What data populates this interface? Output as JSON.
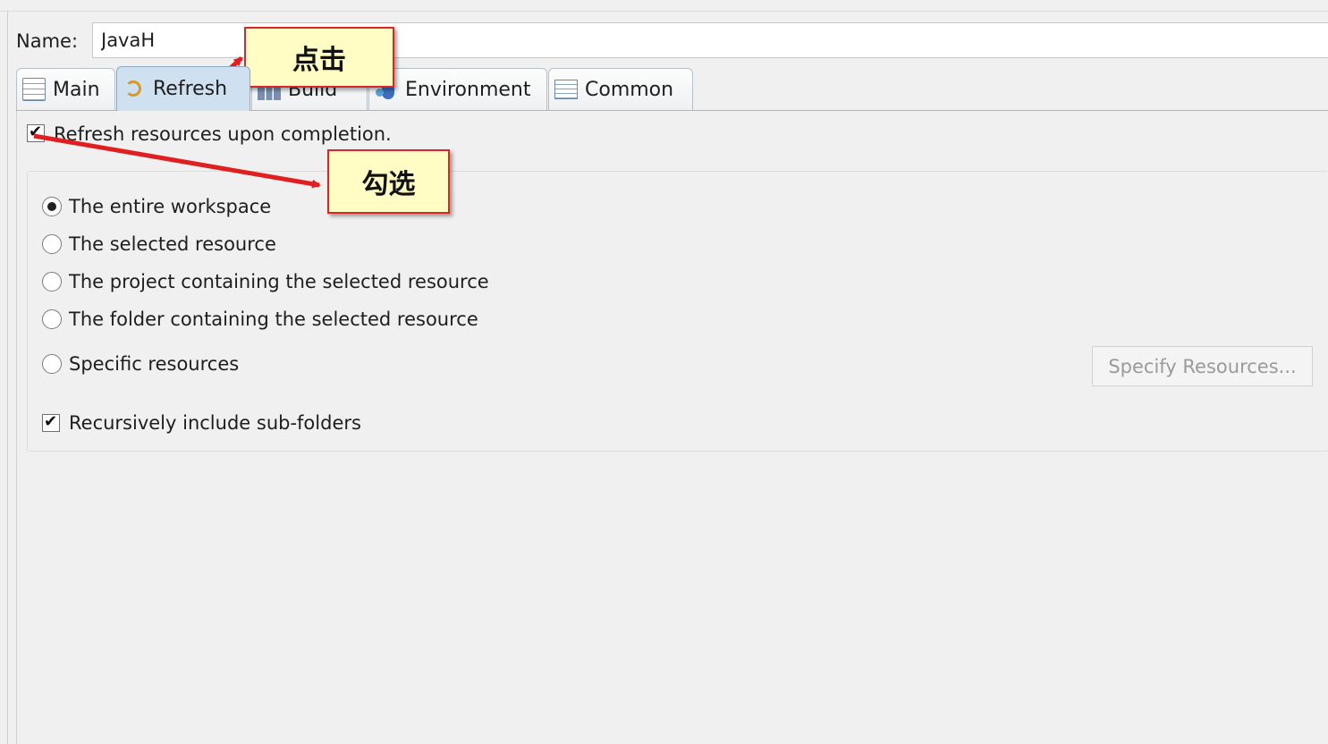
{
  "name_row": {
    "label": "Name:",
    "value": "JavaH"
  },
  "tabs": [
    {
      "label": "Main",
      "icon": "main-tab-icon",
      "active": false
    },
    {
      "label": "Refresh",
      "icon": "refresh-icon",
      "active": true
    },
    {
      "label": "Build",
      "icon": "build-icon",
      "active": false
    },
    {
      "label": "Environment",
      "icon": "environment-icon",
      "active": false
    },
    {
      "label": "Common",
      "icon": "common-icon",
      "active": false
    }
  ],
  "refresh": {
    "refresh_on_completion_label": "Refresh resources upon completion.",
    "refresh_on_completion_checked": true,
    "options": [
      {
        "label": "The entire workspace",
        "selected": true
      },
      {
        "label": "The selected resource",
        "selected": false
      },
      {
        "label": "The project containing the selected resource",
        "selected": false
      },
      {
        "label": "The folder containing the selected resource",
        "selected": false
      },
      {
        "label": "Specific resources",
        "selected": false
      }
    ],
    "specify_resources_button": "Specify Resources...",
    "specify_resources_enabled": false,
    "recursive_label": "Recursively include sub-folders",
    "recursive_checked": true
  },
  "annotations": {
    "click_note": "点击",
    "check_note": "勾选"
  },
  "colors": {
    "annotation_border": "#d8262b",
    "annotation_fill": "#fffcc4",
    "arrow": "#e02020",
    "active_tab": "#cfe0f1"
  }
}
